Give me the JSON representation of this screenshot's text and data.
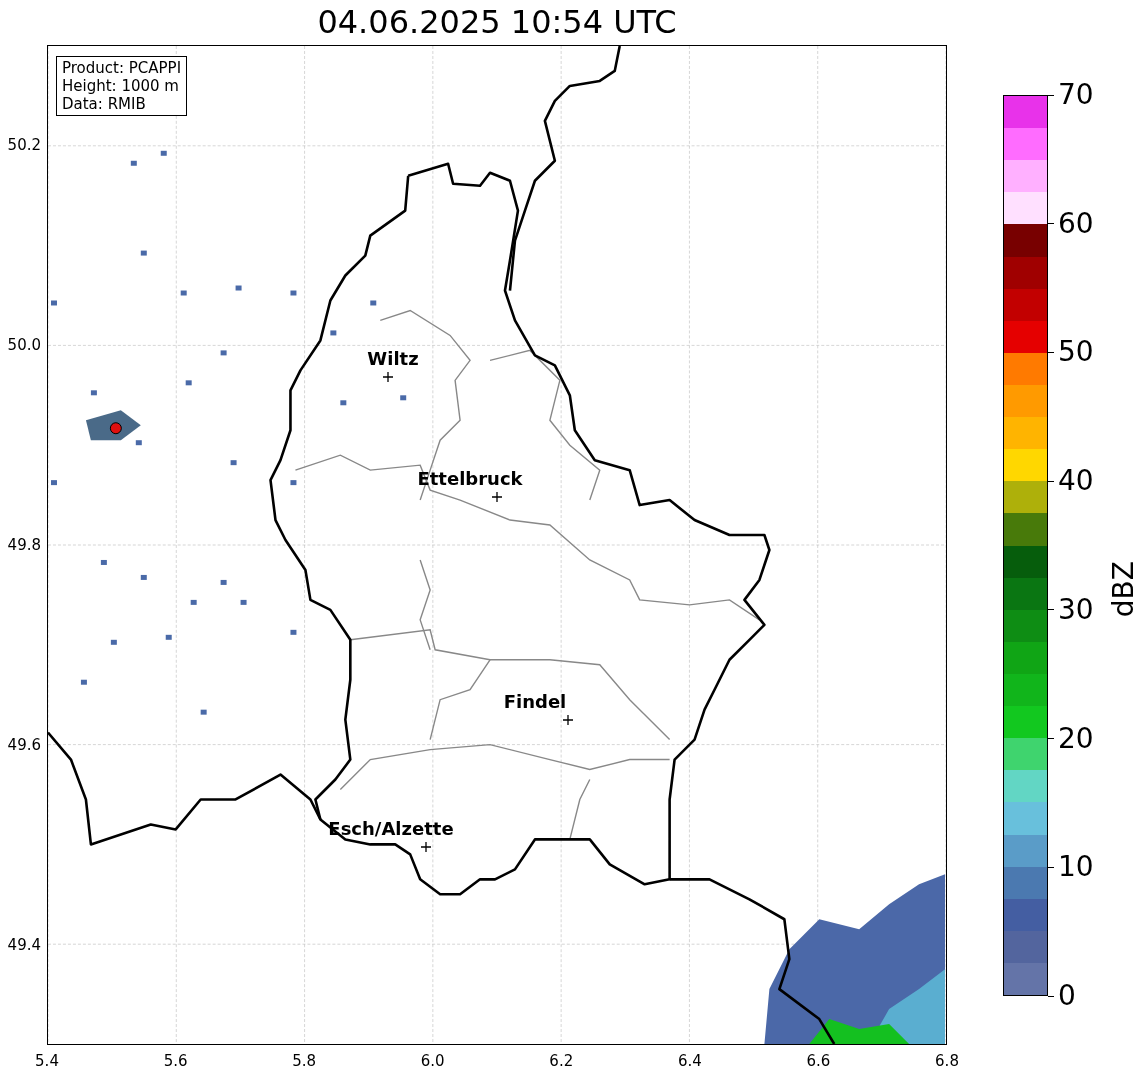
{
  "title": "04.06.2025 10:54 UTC",
  "info_box": [
    "Product: PCAPPI",
    "Height: 1000 m",
    "Data: RMIB"
  ],
  "map": {
    "cities": [
      {
        "name": "Wiltz"
      },
      {
        "name": "Ettelbruck"
      },
      {
        "name": "Findel"
      },
      {
        "name": "Esch/Alzette"
      }
    ],
    "x_ticks": [
      "5.4",
      "5.6",
      "5.8",
      "6.0",
      "6.2",
      "6.4",
      "6.6",
      "6.8"
    ],
    "y_ticks": [
      "50.2",
      "50.0",
      "49.8",
      "49.6",
      "49.4"
    ]
  },
  "colorbar": {
    "label": "dBZ",
    "ticks": [
      "70",
      "60",
      "50",
      "40",
      "30",
      "20",
      "10",
      "0"
    ],
    "bands": [
      {
        "color": "#e832ea"
      },
      {
        "color": "#ff6cff"
      },
      {
        "color": "#ffb0ff"
      },
      {
        "color": "#ffe0ff"
      },
      {
        "color": "#780000"
      },
      {
        "color": "#a00000"
      },
      {
        "color": "#c20000"
      },
      {
        "color": "#e50000"
      },
      {
        "color": "#ff7a00"
      },
      {
        "color": "#ff9a00"
      },
      {
        "color": "#ffb400"
      },
      {
        "color": "#ffd700"
      },
      {
        "color": "#aeb00a"
      },
      {
        "color": "#487a0a"
      },
      {
        "color": "#065d0c"
      },
      {
        "color": "#0a7612"
      },
      {
        "color": "#0e8d14"
      },
      {
        "color": "#10a515"
      },
      {
        "color": "#11b51b"
      },
      {
        "color": "#12c81f"
      },
      {
        "color": "#3fd46e"
      },
      {
        "color": "#62d6c4"
      },
      {
        "color": "#68c0dc"
      },
      {
        "color": "#5a9cc8"
      },
      {
        "color": "#4b79b0"
      },
      {
        "color": "#445ea2"
      },
      {
        "color": "#53659e"
      },
      {
        "color": "#6474a8"
      }
    ]
  }
}
